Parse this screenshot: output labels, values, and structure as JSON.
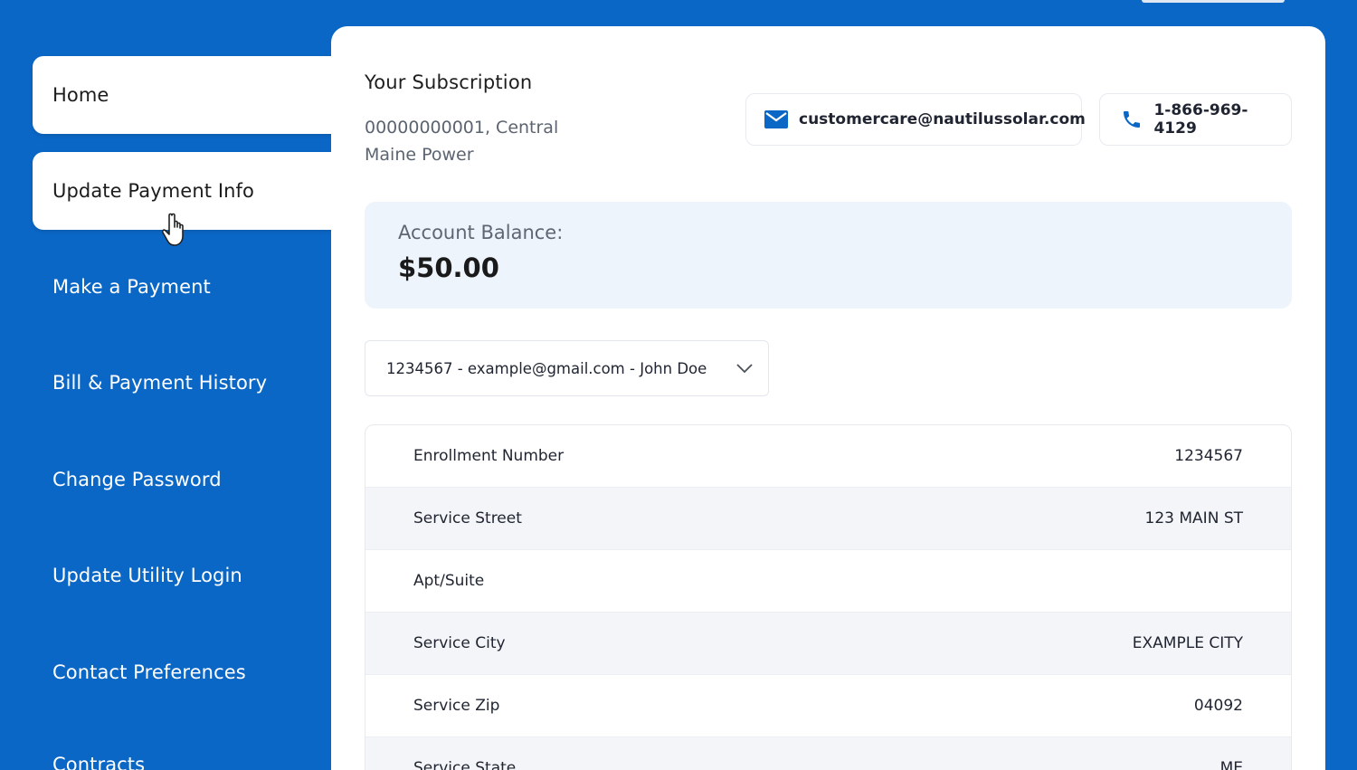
{
  "sidebar": {
    "items": [
      {
        "label": "Home",
        "active": true
      },
      {
        "label": "Update Payment Info",
        "active": true
      },
      {
        "label": "Make a Payment"
      },
      {
        "label": "Bill & Payment History"
      },
      {
        "label": "Change Password"
      },
      {
        "label": "Update Utility Login"
      },
      {
        "label": "Contact Preferences"
      },
      {
        "label": "Contracts"
      }
    ]
  },
  "subscription": {
    "title": "Your Subscription",
    "detail": "00000000001, Central Maine Power"
  },
  "contact": {
    "email": "customercare@nautilussolar.com",
    "email_icon": "mail-icon",
    "phone": "1-866-969-4129",
    "phone_icon": "phone-icon"
  },
  "balance": {
    "label": "Account Balance:",
    "value": "$50.00"
  },
  "account_selector": {
    "value": "1234567 - example@gmail.com - John Doe"
  },
  "details": {
    "rows": [
      {
        "label": "Enrollment Number",
        "value": "1234567"
      },
      {
        "label": "Service Street",
        "value": "123 MAIN ST"
      },
      {
        "label": "Apt/Suite",
        "value": ""
      },
      {
        "label": "Service City",
        "value": "EXAMPLE CITY"
      },
      {
        "label": "Service Zip",
        "value": "04092"
      },
      {
        "label": "Service State",
        "value": "ME"
      }
    ]
  },
  "colors": {
    "brand_blue": "#0b67c6",
    "balance_bg": "#eef4fc"
  }
}
